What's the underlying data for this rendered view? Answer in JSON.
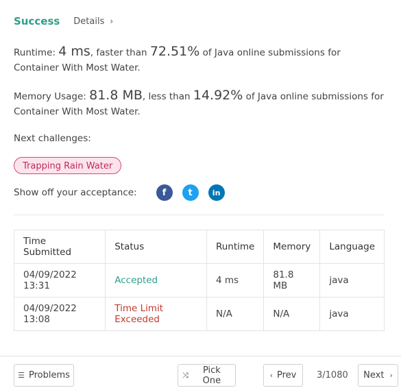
{
  "result": {
    "status": "Success",
    "details_label": "Details",
    "details_chevron": "›"
  },
  "runtime": {
    "label": "Runtime:",
    "value": "4 ms",
    "mid": ", faster than",
    "percent": "72.51%",
    "suffix": "of Java online submissions for Container With Most Water."
  },
  "memory": {
    "label": "Memory Usage:",
    "value": "81.8 MB",
    "mid": ", less than",
    "percent": "14.92%",
    "suffix": "of Java online submissions for Container With Most Water."
  },
  "next_challenges": {
    "title": "Next challenges:",
    "items": [
      "Trapping Rain Water"
    ]
  },
  "share": {
    "label": "Show off your acceptance:",
    "icons": [
      "facebook-icon",
      "twitter-icon",
      "linkedin-icon"
    ],
    "glyphs": [
      "f",
      "t",
      "in"
    ]
  },
  "submissions": {
    "headers": [
      "Time Submitted",
      "Status",
      "Runtime",
      "Memory",
      "Language"
    ],
    "rows": [
      {
        "time": "04/09/2022 13:31",
        "status": "Accepted",
        "runtime": "4 ms",
        "memory": "81.8 MB",
        "language": "java"
      },
      {
        "time": "04/09/2022 13:08",
        "status": "Time Limit Exceeded",
        "runtime": "N/A",
        "memory": "N/A",
        "language": "java"
      }
    ]
  },
  "footer": {
    "problems_label": "Problems",
    "problems_icon": "☰",
    "pick_label": "Pick One",
    "pick_icon": "⤨",
    "prev_label": "Prev",
    "prev_icon": "‹",
    "page": "3/1080",
    "next_label": "Next",
    "next_icon": "›"
  },
  "colors": {
    "accent": "#2f9e8b",
    "error": "#c0392b",
    "tag_border": "#d6457c",
    "tag_bg": "#fce4ec"
  }
}
